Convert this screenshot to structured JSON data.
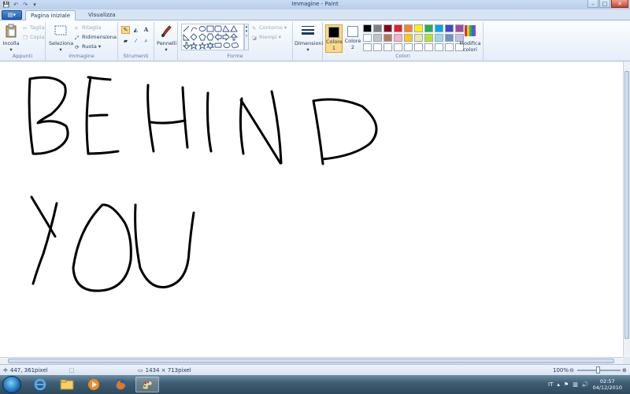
{
  "window": {
    "title": "Immagine - Paint",
    "minimize": "–",
    "maximize": "□",
    "close": "✕"
  },
  "quick_access": [
    "save-icon",
    "undo-icon",
    "redo-icon"
  ],
  "app_menu_icon": "paint-menu-icon",
  "tabs": [
    {
      "label": "Pagina iniziale",
      "active": true
    },
    {
      "label": "Visualizza",
      "active": false
    }
  ],
  "ribbon": {
    "clipboard": {
      "label": "Appunti",
      "paste": "Incolla",
      "cut": "Taglia",
      "copy": "Copia"
    },
    "image": {
      "label": "Immagine",
      "select": "Seleziona",
      "crop": "Ritaglia",
      "resize": "Ridimensiona",
      "rotate": "Ruota"
    },
    "tools": {
      "label": "Strumenti"
    },
    "brushes": {
      "label": "Pennelli"
    },
    "shapes": {
      "label": "Forme",
      "outline": "Contorno",
      "fill": "Riempi"
    },
    "size": {
      "label": "Dimensioni"
    },
    "colors": {
      "label": "Colori",
      "color1_label": "Colore",
      "color1_num": "1",
      "color2_label": "Colore",
      "color2_num": "2",
      "edit": "Modifica colori",
      "color1": "#000000",
      "color2": "#ffffff",
      "palette": [
        "#000000",
        "#7f7f7f",
        "#880015",
        "#ed1c24",
        "#ff7f27",
        "#fff200",
        "#22b14c",
        "#00a2e8",
        "#3f48cc",
        "#a349a4",
        "#ffffff",
        "#c3c3c3",
        "#b97a57",
        "#ffaec9",
        "#ffc90e",
        "#efe4b0",
        "#b5e61d",
        "#99d9ea",
        "#7092be",
        "#c8bfe7",
        "#ffffff",
        "#ffffff",
        "#ffffff",
        "#ffffff",
        "#ffffff",
        "#ffffff",
        "#ffffff",
        "#ffffff",
        "#ffffff",
        "#ffffff"
      ]
    }
  },
  "status": {
    "cursor_pos": "447, 361pixel",
    "image_size": "1434 × 713pixel",
    "zoom": "100%"
  },
  "taskbar": {
    "apps": [
      "ie-icon",
      "explorer-icon",
      "media-player-icon",
      "firefox-icon",
      "paint-icon"
    ],
    "lang": "IT",
    "time": "02:57",
    "date": "04/12/2010"
  }
}
